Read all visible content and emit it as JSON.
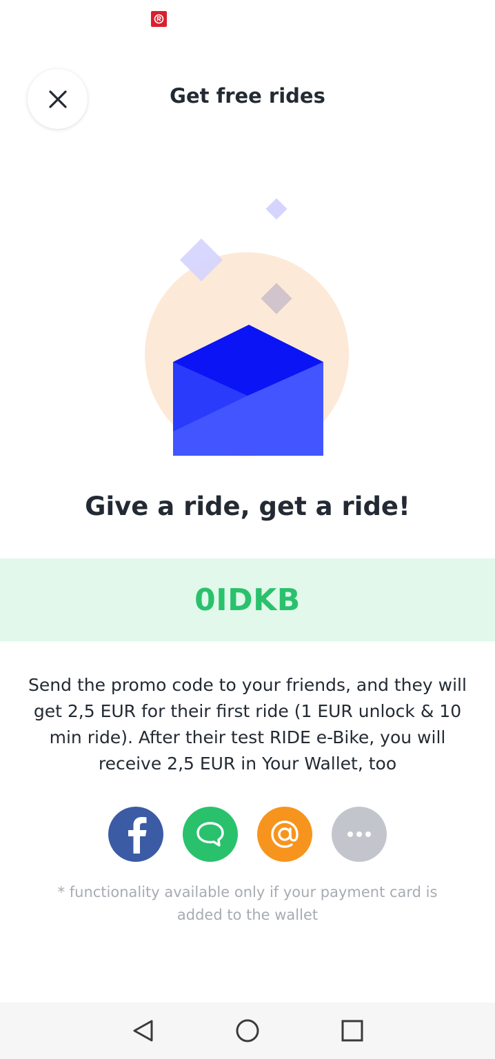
{
  "header": {
    "title": "Get free rides",
    "close_icon": "close-icon",
    "status_app_icon": "ride-app-icon"
  },
  "hero": {
    "illustration": "open-envelope-illustration",
    "headline": "Give a ride, get a ride!"
  },
  "promo": {
    "code": "0IDKB",
    "description": "Send the promo code to your friends, and they will get 2,5 EUR for their first ride (1 EUR unlock & 10 min ride). After their test RIDE e-Bike, you will receive 2,5 EUR in Your Wallet, too"
  },
  "share": [
    {
      "name": "facebook",
      "icon": "facebook-icon",
      "color": "#3b5ba5"
    },
    {
      "name": "message",
      "icon": "chat-bubble-icon",
      "color": "#2ac16d"
    },
    {
      "name": "email",
      "icon": "at-sign-icon",
      "color": "#f7941e"
    },
    {
      "name": "more",
      "icon": "more-dots-icon",
      "color": "#c3c5cd"
    }
  ],
  "note": "* functionality available only if your payment card is added to the wallet",
  "navbar": {
    "back_icon": "back-triangle-icon",
    "home_icon": "home-circle-icon",
    "recents_icon": "recents-square-icon"
  },
  "colors": {
    "promo_bg": "#e1f8eb",
    "promo_text": "#2ac16d",
    "envelope": "#4355ff",
    "envelope_flap": "#0a14f5",
    "circle": "#fde9d7"
  }
}
